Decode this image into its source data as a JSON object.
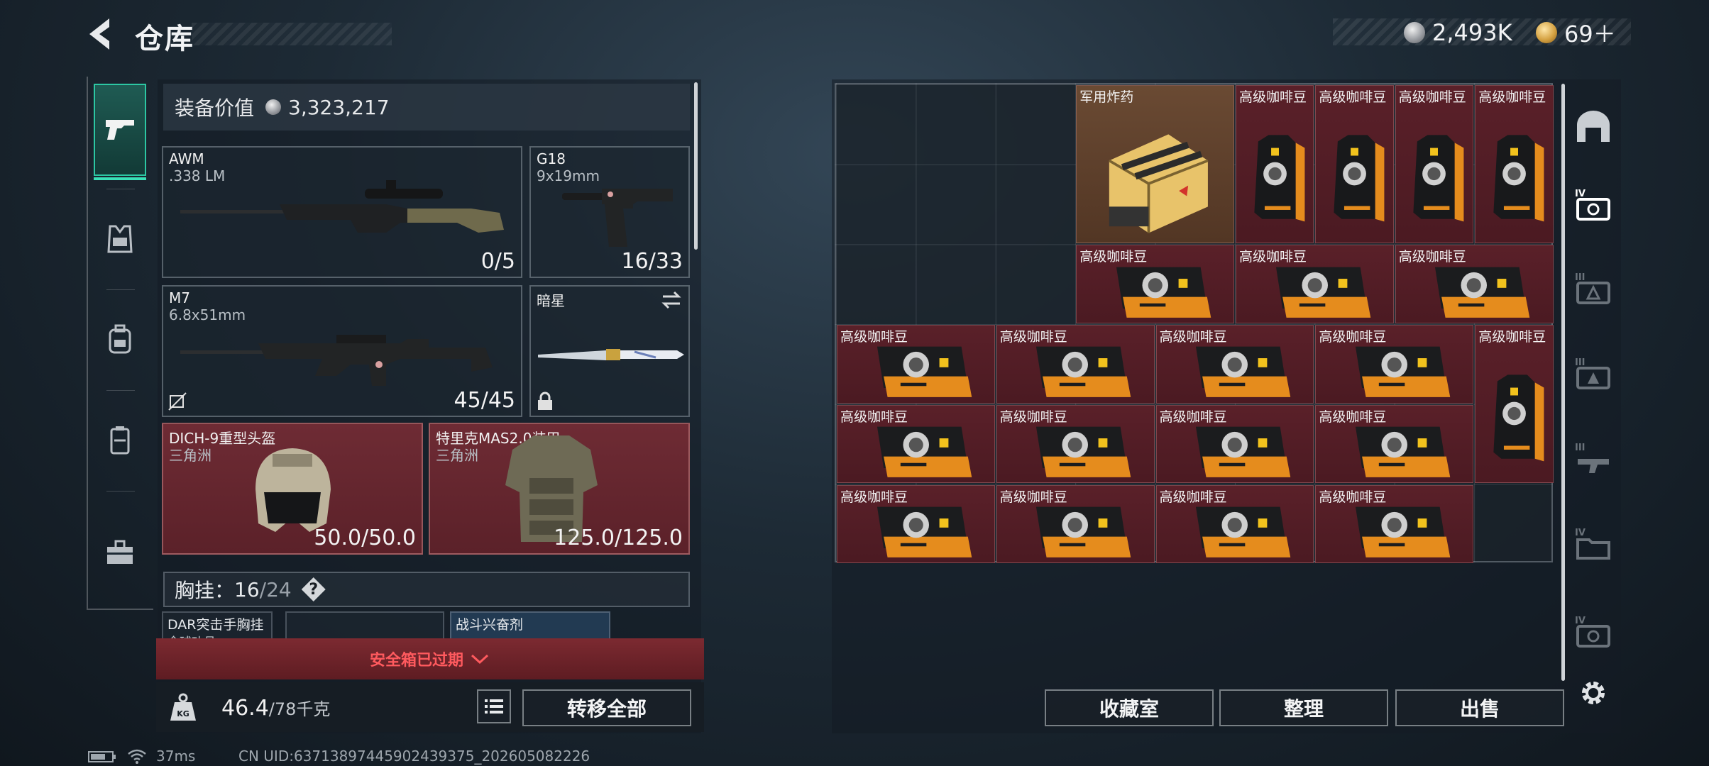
{
  "header": {
    "title": "仓库"
  },
  "currency": {
    "coins": "2,493K",
    "premium": "69＋"
  },
  "rail": {
    "tabs": [
      "pistol-icon",
      "vest-icon",
      "backpack-icon",
      "safebox-icon",
      "toolbox-icon"
    ]
  },
  "equipment": {
    "value_label": "装备价值",
    "value": "3,323,217",
    "primary": {
      "name": "AWM",
      "ammo": ".338 LM",
      "count": "0/5"
    },
    "sidearm": {
      "name": "G18",
      "ammo": "9x19mm",
      "count": "16/33"
    },
    "secondary": {
      "name": "M7",
      "ammo": "6.8x51mm",
      "count": "45/45"
    },
    "melee": {
      "name": "暗星"
    },
    "helmet": {
      "name": "DICH-9重型头盔",
      "sub": "三角洲",
      "durability": "50.0/50.0"
    },
    "armor": {
      "name": "特里克MAS2.0装甲",
      "sub": "三角洲",
      "durability": "125.0/125.0"
    },
    "vest": {
      "label": "胸挂：",
      "used": "16",
      "capacity": "/24",
      "help": "?"
    },
    "vest_items": [
      "DAR突击手胸挂",
      "战斗兴奋剂"
    ],
    "vest_item_sub": "全球功县"
  },
  "safebox": {
    "status": "安全箱已过期"
  },
  "capacity": {
    "weight": "46.4",
    "max": "/78千克",
    "kg_label": "KG"
  },
  "actions": {
    "transfer_all": "转移全部",
    "collection": "收藏室",
    "sort": "整理",
    "sell": "出售"
  },
  "storage": {
    "items": [
      {
        "label": "军用炸药",
        "kind": "explosive"
      },
      {
        "label": "高级咖啡豆",
        "kind": "coffee-bag"
      },
      {
        "label": "高级咖啡豆",
        "kind": "coffee-bag"
      },
      {
        "label": "高级咖啡豆",
        "kind": "coffee-bag"
      },
      {
        "label": "高级咖啡豆",
        "kind": "coffee-bag"
      },
      {
        "label": "高级咖啡豆",
        "kind": "coffee-pack"
      },
      {
        "label": "高级咖啡豆",
        "kind": "coffee-pack"
      },
      {
        "label": "高级咖啡豆",
        "kind": "coffee-pack"
      },
      {
        "label": "高级咖啡豆",
        "kind": "coffee-pack"
      },
      {
        "label": "高级咖啡豆",
        "kind": "coffee-pack"
      },
      {
        "label": "高级咖啡豆",
        "kind": "coffee-pack"
      },
      {
        "label": "高级咖啡豆",
        "kind": "coffee-pack"
      },
      {
        "label": "高级咖啡豆",
        "kind": "coffee-bag"
      },
      {
        "label": "高级咖啡豆",
        "kind": "coffee-pack"
      },
      {
        "label": "高级咖啡豆",
        "kind": "coffee-pack"
      },
      {
        "label": "高级咖啡豆",
        "kind": "coffee-pack"
      },
      {
        "label": "高级咖啡豆",
        "kind": "coffee-pack"
      },
      {
        "label": "高级咖啡豆",
        "kind": "coffee-pack"
      },
      {
        "label": "高级咖啡豆",
        "kind": "coffee-pack"
      },
      {
        "label": "高级咖啡豆",
        "kind": "coffee-pack"
      },
      {
        "label": "高级咖啡豆",
        "kind": "coffee-pack"
      }
    ]
  },
  "categories": {
    "tiers": [
      "",
      "IV",
      "III",
      "III",
      "III",
      "IV",
      "IV"
    ]
  },
  "status_bar": {
    "ping": "37ms",
    "uid": "CN UID:63713897445902439375_202605082226"
  },
  "colors": {
    "accent": "#2cc7a3",
    "item_red": "#5a2029",
    "alert": "#ff5a5e"
  }
}
